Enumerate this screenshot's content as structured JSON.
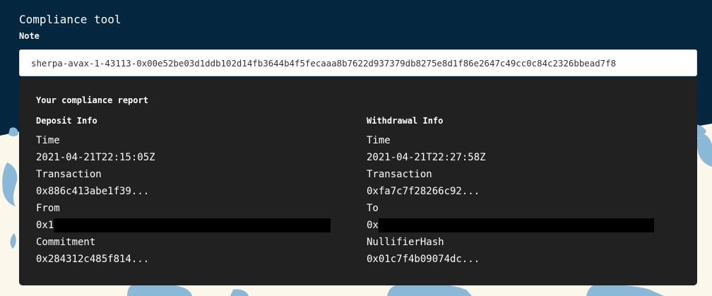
{
  "app": {
    "title": "Compliance tool"
  },
  "note": {
    "label": "Note",
    "value": "sherpa-avax-1-43113-0x00e52be03d1ddb102d14fb3644b4f5fecaaa8b7622d937379db8275e8d1f86e2647c49cc0c84c2326bbead7f8"
  },
  "report": {
    "title": "Your compliance report",
    "deposit": {
      "heading": "Deposit Info",
      "time_label": "Time",
      "time_value": "2021-04-21T22:15:05Z",
      "tx_label": "Transaction",
      "tx_value": "0x886c413abe1f39...",
      "addr_label": "From",
      "addr_value_visible": "0x1",
      "commit_label": "Commitment",
      "commit_value": "0x284312c485f814..."
    },
    "withdrawal": {
      "heading": "Withdrawal Info",
      "time_label": "Time",
      "time_value": "2021-04-21T22:27:58Z",
      "tx_label": "Transaction",
      "tx_value": "0xfa7c7f28266c92...",
      "addr_label": "To",
      "addr_value_visible": "0x",
      "nullifier_label": "NullifierHash",
      "nullifier_value": "0x01c7f4b09074dc..."
    }
  },
  "colors": {
    "header_bg": "#04263e",
    "page_bg": "#fbf7ea",
    "card_bg": "#212121",
    "decor_blue": "#8ab9d8"
  }
}
